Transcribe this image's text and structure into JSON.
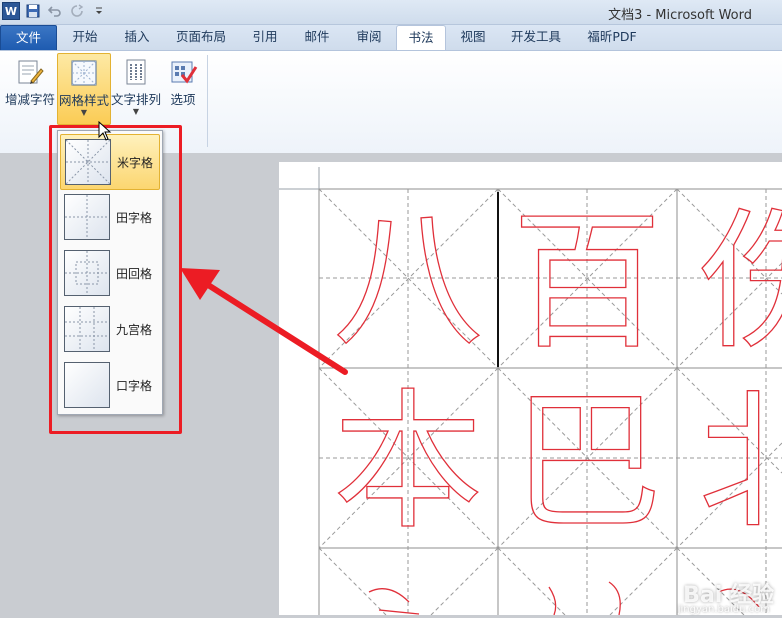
{
  "title_bar": {
    "title": "文档3 - Microsoft Word",
    "app_icon": "W"
  },
  "tabs": [
    {
      "label": "文件"
    },
    {
      "label": "开始"
    },
    {
      "label": "插入"
    },
    {
      "label": "页面布局"
    },
    {
      "label": "引用"
    },
    {
      "label": "邮件"
    },
    {
      "label": "审阅"
    },
    {
      "label": "书法"
    },
    {
      "label": "视图"
    },
    {
      "label": "开发工具"
    },
    {
      "label": "福昕PDF"
    }
  ],
  "active_tab": "书法",
  "ribbon": {
    "buttons": [
      {
        "label": "增减字符",
        "icon": "add-remove-chars-icon"
      },
      {
        "label": "网格样式",
        "icon": "grid-style-icon",
        "has_dropdown": true,
        "pressed": true
      },
      {
        "label": "文字排列",
        "icon": "text-arrange-icon",
        "has_dropdown": true
      },
      {
        "label": "选项",
        "icon": "options-icon"
      }
    ]
  },
  "grid_style_menu": {
    "items": [
      {
        "label": "米字格",
        "selected": true
      },
      {
        "label": "田字格"
      },
      {
        "label": "田回格"
      },
      {
        "label": "九宫格"
      },
      {
        "label": "口字格"
      }
    ]
  },
  "document": {
    "characters": [
      "八",
      "百",
      "伤",
      "本",
      "巴",
      "北"
    ]
  },
  "colors": {
    "accent_red": "#ec1c24",
    "calligraphy_outline": "#e0303a",
    "file_tab": "#2b5797"
  },
  "watermark": {
    "text": "Bai 经验",
    "sub": "jingyan.baidu.com"
  }
}
